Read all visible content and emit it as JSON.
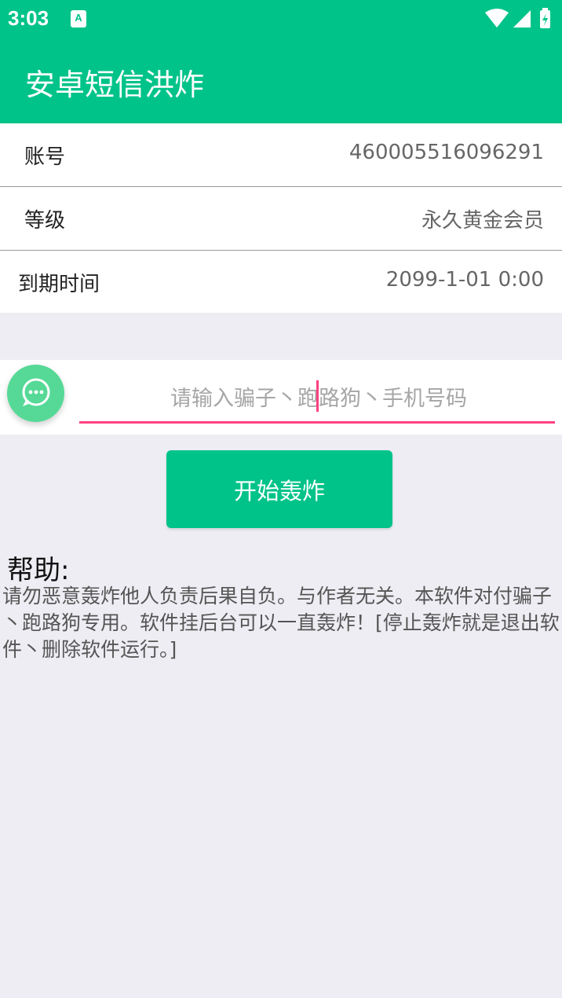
{
  "status_bar": {
    "time": "3:03",
    "notification_icon": "A",
    "icons": [
      "wifi-icon",
      "cell-signal-icon",
      "battery-charging-icon"
    ]
  },
  "app_bar": {
    "title": "安卓短信洪炸"
  },
  "account_info": {
    "rows": [
      {
        "label": "账号",
        "value": "460005516096291"
      },
      {
        "label": "等级",
        "value": "永久黄金会员"
      },
      {
        "label": "到期时间",
        "value": "2099-1-01 0:00"
      }
    ]
  },
  "phone_input": {
    "placeholder": "请输入骗子丶跑路狗丶手机号码",
    "value": ""
  },
  "start_button": {
    "label": "开始轰炸"
  },
  "help": {
    "title": "帮助:",
    "body": "请勿恶意轰炸他人负责后果自负。与作者无关。本软件对付骗子丶跑路狗专用。软件挂后台可以一直轰炸！[停止轰炸就是退出软件丶删除软件运行。]"
  },
  "colors": {
    "primary": "#00c389",
    "accent": "#ff4081",
    "background": "#eeedf3",
    "fab": "#56d996"
  }
}
